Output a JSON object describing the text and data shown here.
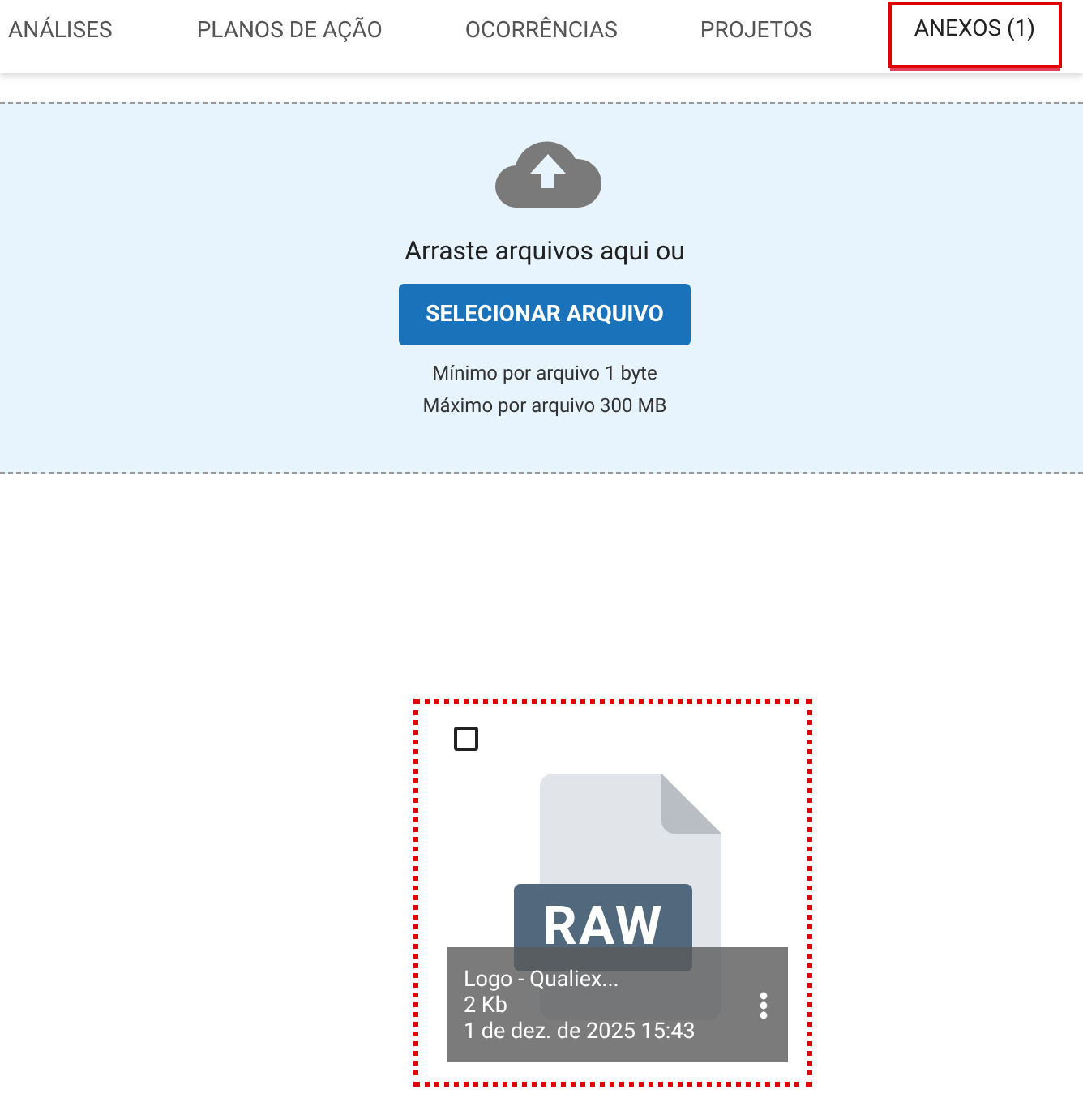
{
  "tabs": [
    {
      "label": "ANÁLISES",
      "selected": false
    },
    {
      "label": "PLANOS DE AÇÃO",
      "selected": false
    },
    {
      "label": "OCORRÊNCIAS",
      "selected": false
    },
    {
      "label": "PROJETOS",
      "selected": false
    },
    {
      "label": "ANEXOS (1)",
      "selected": true
    }
  ],
  "dropzone": {
    "prompt": "Arraste arquivos aqui ou",
    "button": "SELECIONAR ARQUIVO",
    "limits": [
      "Mínimo por arquivo 1 byte",
      "Máximo por arquivo 300 MB"
    ]
  },
  "files": [
    {
      "file_type": "RAW",
      "name": "Logo - Qualiex...",
      "size": "2 Kb",
      "date": "1 de dez. de 2025 15:43",
      "checked": false
    }
  ]
}
